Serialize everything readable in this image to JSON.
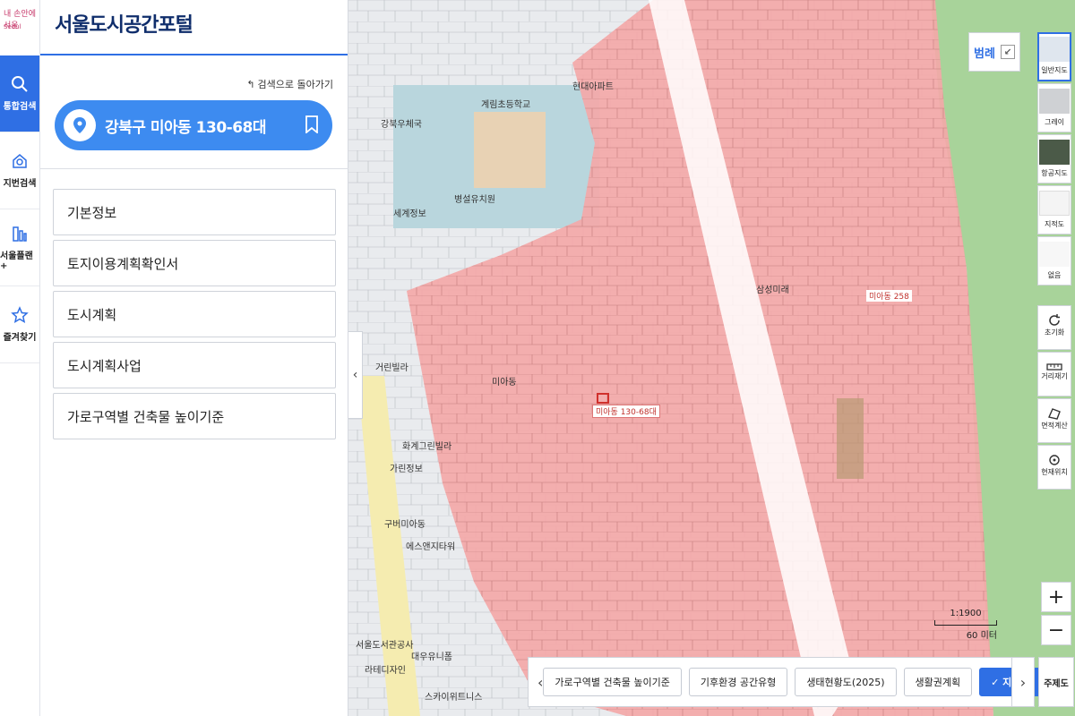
{
  "brand": {
    "logo_text": "내 손안에 서울",
    "logo_sub": "Seoul"
  },
  "nav": {
    "items": [
      {
        "label": "통합검색",
        "icon": "search-icon",
        "active": true
      },
      {
        "label": "지번검색",
        "icon": "house-search-icon",
        "active": false
      },
      {
        "label": "서울플랜+",
        "icon": "building-icon",
        "active": false
      },
      {
        "label": "즐겨찾기",
        "icon": "star-icon",
        "active": false
      }
    ]
  },
  "panel": {
    "title": "서울도시공간포털",
    "back_label": "검색으로 돌아가기",
    "address": "강북구 미아동 130-68대",
    "menu": [
      "기본정보",
      "토지이용계획확인서",
      "도시계획",
      "도시계획사업",
      "가로구역별 건축물 높이기준"
    ]
  },
  "map": {
    "legend_label": "범례",
    "target_label": "미아동 130-68대",
    "dong_label": "미아동 258",
    "labels": [
      "계림초등학교",
      "현대아파트",
      "병설유치원",
      "강북우체국",
      "가린정보",
      "구버미아동",
      "에스앤지타워",
      "서울도서관공사",
      "라테디자인",
      "대우유니폼",
      "스카이위트니스",
      "미아동",
      "삼성미래",
      "화계그린빌라",
      "세계정보",
      "거린빌라"
    ],
    "tools": [
      {
        "label": "일반지도",
        "active": true
      },
      {
        "label": "그레이",
        "active": false
      },
      {
        "label": "항공지도",
        "active": false
      },
      {
        "label": "지적도",
        "active": false
      },
      {
        "label": "없음",
        "active": false
      }
    ],
    "utilities": [
      {
        "label": "초기화",
        "icon": "refresh-icon"
      },
      {
        "label": "거리재기",
        "icon": "ruler-icon"
      },
      {
        "label": "면적계산",
        "icon": "area-icon"
      },
      {
        "label": "현재위치",
        "icon": "location-icon"
      }
    ],
    "zoom_in": "+",
    "zoom_out": "−",
    "scale_ratio": "1:1900",
    "scale_distance": "60 미터",
    "bottom_tabs": [
      {
        "label": "가로구역별 건축물 높이기준",
        "active": false
      },
      {
        "label": "기후환경 공간유형",
        "active": false
      },
      {
        "label": "생태현황도(2025)",
        "active": false
      },
      {
        "label": "생활권계획",
        "active": false
      },
      {
        "label": "✓ 지적도",
        "active": true
      }
    ],
    "theme_label": "주제도"
  },
  "colors": {
    "accent": "#2f6fe4",
    "zone": "#f3a8a8",
    "green": "#a8d39a"
  }
}
